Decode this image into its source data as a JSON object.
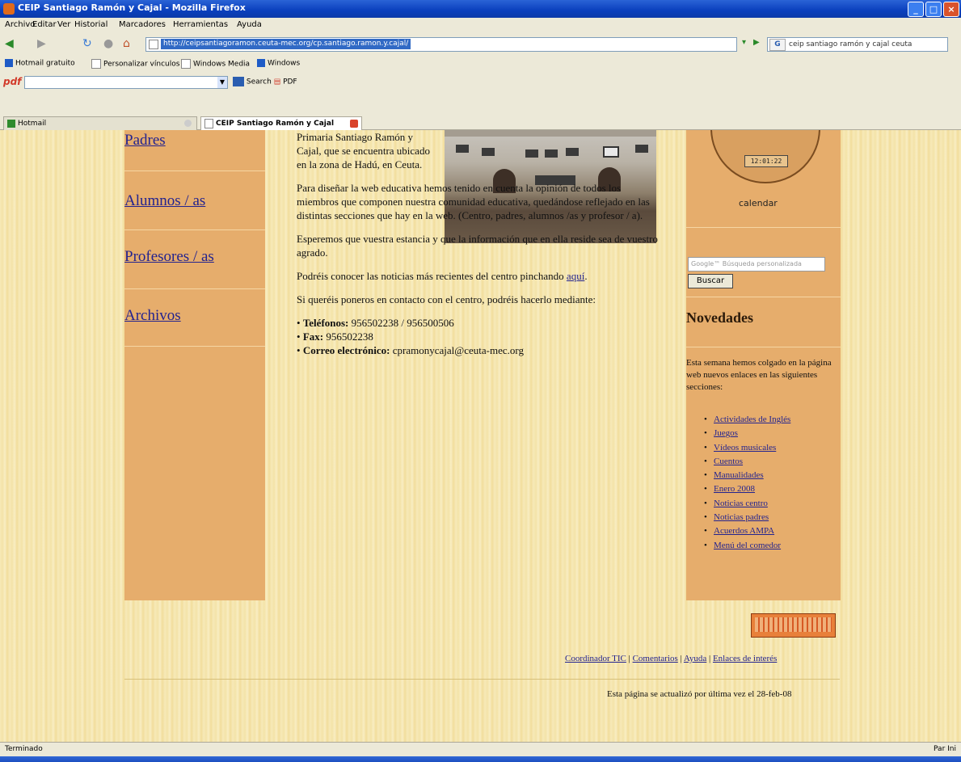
{
  "window": {
    "title": "CEIP Santiago Ramón y Cajal - Mozilla Firefox"
  },
  "menu": [
    "Archivo",
    "Editar",
    "Ver",
    "Historial",
    "Marcadores",
    "Herramientas",
    "Ayuda"
  ],
  "nav": {
    "url": "http://ceipsantiagoramon.ceuta-mec.org/cp.santiago.ramon.y.cajal/",
    "search_engine": "G",
    "search_text": "ceip santiago ramón y cajal ceuta"
  },
  "bookmarks": [
    "Hotmail gratuito",
    "Personalizar vínculos",
    "Windows Media",
    "Windows"
  ],
  "pdfbar": {
    "logo": "pdf",
    "search_label": "Search",
    "pdf_label": "PDF"
  },
  "tabs": [
    {
      "label": "Hotmail"
    },
    {
      "label": "CEIP Santiago Ramón y Cajal"
    }
  ],
  "left_nav": [
    "Padres",
    "Alumnos / as",
    "Profesores / as",
    "Archivos"
  ],
  "main": {
    "p1": "Primaria Santiago Ramón y Cajal, que se encuentra ubicado en la zona de Hadú, en Ceuta.",
    "p2": "Para diseñar la web educativa hemos tenido en cuenta la opinión de todos los miembros que componen nuestra comunidad educativa, quedándose reflejado en las distintas secciones que hay en la web. (Centro, padres, alumnos /as y profesor / a).",
    "p3": "Esperemos que vuestra estancia y que la información que en ella reside sea de vuestro agrado.",
    "p4": "Podréis conocer las noticias más recientes del centro pinchando",
    "p4_link": "aquí",
    "p5": "Si queréis poneros en contacto con el centro, podréis hacerlo mediante:",
    "contacts": [
      {
        "label": "Teléfonos:",
        "value": " 956502238 / 956500506"
      },
      {
        "label": "Fax:",
        "value": " 956502238"
      },
      {
        "label": "Correo electrónico:",
        "value": " cpramonycajal@ceuta-mec.org"
      }
    ]
  },
  "sidebar": {
    "clock_time": "12:01:22",
    "calendar_label": "calendar",
    "search_placeholder": "Google™ Búsqueda personalizada",
    "search_button": "Buscar",
    "news_title": "Novedades",
    "news_text": "Esta semana hemos colgado en la página web nuevos enlaces en las siguientes secciones:",
    "news_items": [
      "Actividades de Inglés",
      "Juegos",
      "Vídeos musicales",
      "Cuentos",
      "Manualidades",
      "Enero 2008",
      "Noticias centro",
      "Noticias padres",
      "Acuerdos AMPA",
      "Menú del comedor"
    ]
  },
  "footer": {
    "links": [
      "Coordinador TIC",
      "Comentarios",
      "Ayuda",
      "Enlaces de interés"
    ],
    "updated": "Esta página se actualizó por última vez el 28-feb-08"
  },
  "status": {
    "left": "Terminado",
    "right": "Par Ini"
  },
  "colors": {
    "column": "#e6ad6c",
    "link": "#23238f",
    "background": "#f6e9b8",
    "titlebar": "#0a3fbd"
  }
}
